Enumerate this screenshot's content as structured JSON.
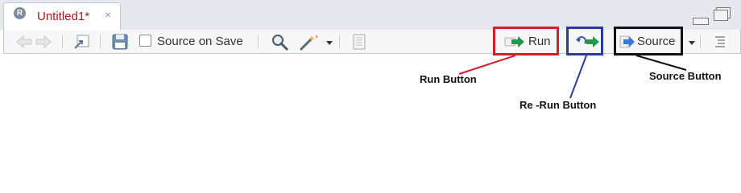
{
  "tab": {
    "title": "Untitled1*",
    "close_glyph": "×",
    "r_badge": "R"
  },
  "toolbar": {
    "source_on_save_label": "Source on Save",
    "run_label": "Run",
    "source_label": "Source"
  },
  "annotations": {
    "run": "Run Button",
    "rerun": "Re -Run Button",
    "source": "Source Button"
  },
  "colors": {
    "run_box": "#d0202a",
    "rerun_box": "#2b3aa6",
    "source_box": "#111111",
    "run_arrow": "#1e9b4a"
  }
}
